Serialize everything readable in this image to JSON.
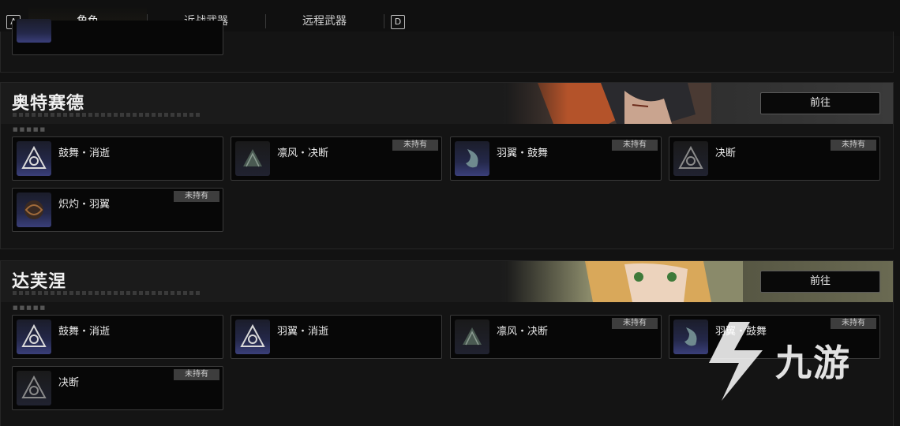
{
  "tabs": {
    "left_key": "A",
    "right_key": "D",
    "items": [
      {
        "label": "角色",
        "active": true
      },
      {
        "label": "近战武器",
        "active": false
      },
      {
        "label": "远程武器",
        "active": false
      }
    ]
  },
  "sections": [
    {
      "name": "奥特赛德",
      "goto_label": "前往",
      "cards": [
        {
          "label": "鼓舞・消逝",
          "owned": true,
          "icon": "triad-emblem-icon"
        },
        {
          "label": "凛风・决断",
          "owned": false,
          "badge": "未持有",
          "icon": "wing-emblem-icon"
        },
        {
          "label": "羽翼・鼓舞",
          "owned": false,
          "badge": "未持有",
          "icon": "feather-emblem-icon"
        },
        {
          "label": "决断",
          "owned": false,
          "badge": "未持有",
          "icon": "triad-emblem-icon"
        },
        {
          "label": "炽灼・羽翼",
          "owned": false,
          "badge": "未持有",
          "icon": "flame-emblem-icon"
        }
      ]
    },
    {
      "name": "达芙涅",
      "goto_label": "前往",
      "cards": [
        {
          "label": "鼓舞・消逝",
          "owned": true,
          "icon": "triad-emblem-icon"
        },
        {
          "label": "羽翼・消逝",
          "owned": true,
          "icon": "triad-emblem-icon"
        },
        {
          "label": "凛风・决断",
          "owned": false,
          "badge": "未持有",
          "icon": "wing-emblem-icon"
        },
        {
          "label": "羽翼・鼓舞",
          "owned": false,
          "badge": "未持有",
          "icon": "feather-emblem-icon"
        },
        {
          "label": "决断",
          "owned": false,
          "badge": "未持有",
          "icon": "triad-emblem-icon"
        }
      ]
    }
  ],
  "watermark": {
    "text": "九游"
  },
  "colors": {
    "accent": "#d8cba0",
    "badge_bg": "#3d3d3d",
    "card_bg": "#070707"
  }
}
